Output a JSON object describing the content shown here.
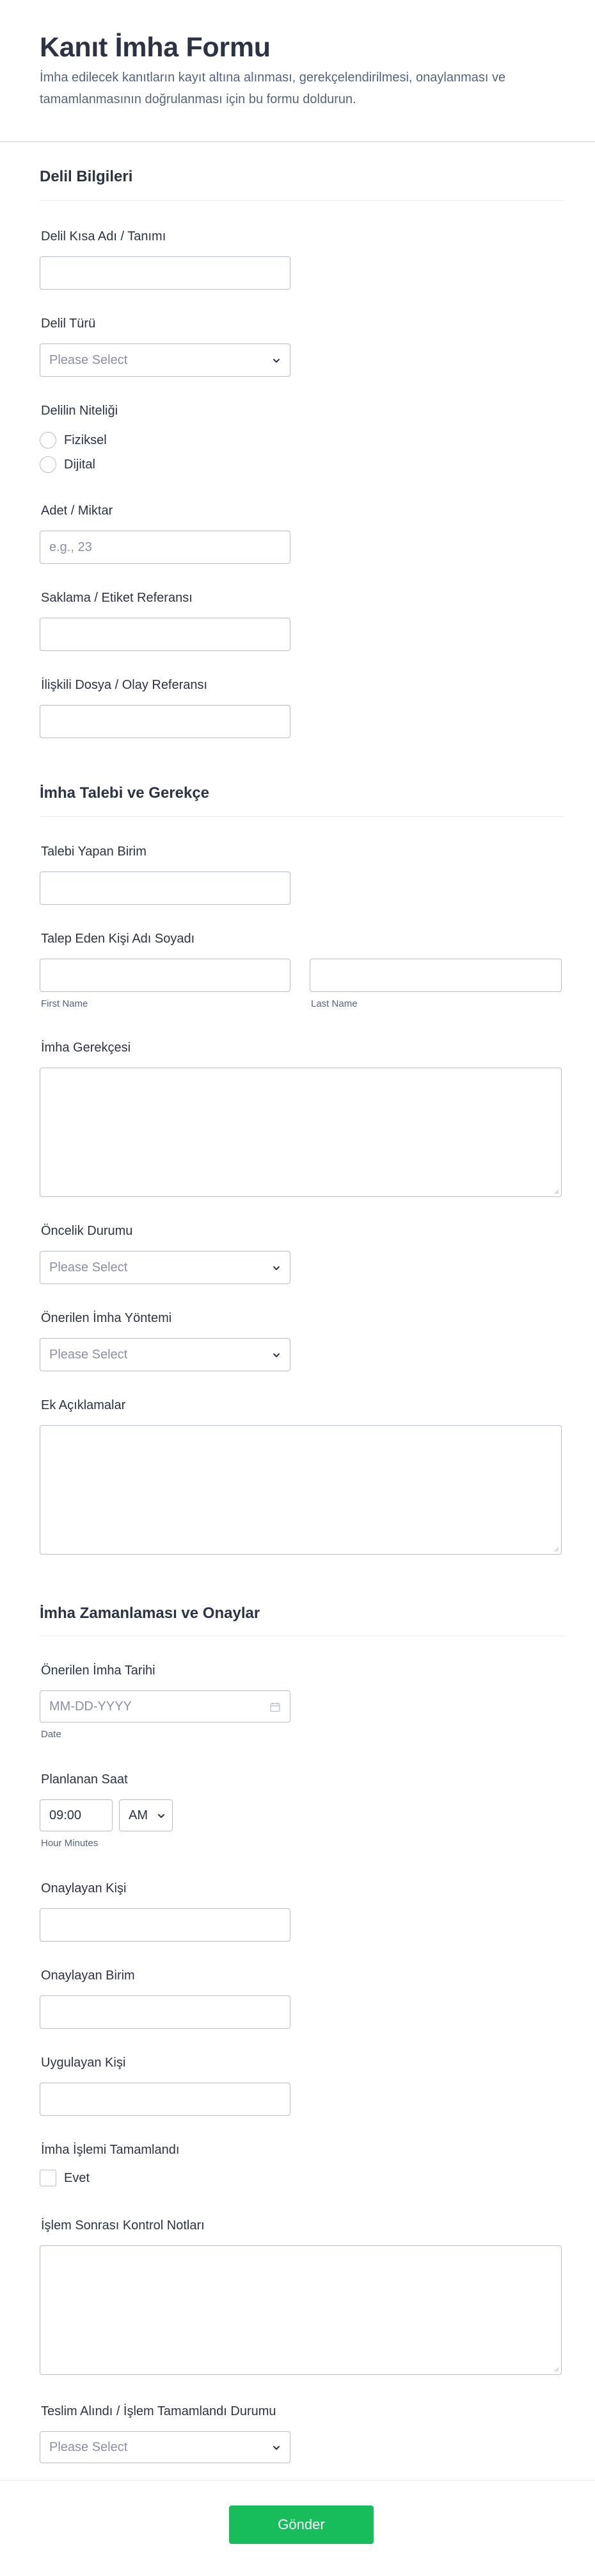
{
  "form": {
    "title": "Kanıt İmha Formu",
    "subtitle": "İmha edilecek kanıtların kayıt altına alınması, gerekçelendirilmesi, onaylanması ve tamamlanmasının doğrulanması için bu formu doldurun."
  },
  "sections": {
    "evidence": "Delil Bilgileri",
    "request": "İmha Talebi ve Gerekçe",
    "schedule": "İmha Zamanlaması ve Onaylar"
  },
  "fields": {
    "evidence_name": {
      "label": "Delil Kısa Adı / Tanımı",
      "value": ""
    },
    "evidence_type": {
      "label": "Delil Türü",
      "placeholder": "Please Select"
    },
    "evidence_nature": {
      "label": "Delilin Niteliği",
      "options": [
        "Fiziksel",
        "Dijital"
      ]
    },
    "quantity": {
      "label": "Adet / Miktar",
      "placeholder": "e.g., 23"
    },
    "storage_ref": {
      "label": "Saklama / Etiket Referansı",
      "value": ""
    },
    "case_ref": {
      "label": "İlişkili Dosya / Olay Referansı",
      "value": ""
    },
    "requesting_unit": {
      "label": "Talebi Yapan Birim",
      "value": ""
    },
    "requester_name": {
      "label": "Talep Eden Kişi Adı Soyadı",
      "first_sublabel": "First Name",
      "last_sublabel": "Last Name"
    },
    "reason": {
      "label": "İmha Gerekçesi",
      "value": ""
    },
    "priority": {
      "label": "Öncelik Durumu",
      "placeholder": "Please Select"
    },
    "method": {
      "label": "Önerilen İmha Yöntemi",
      "placeholder": "Please Select"
    },
    "notes": {
      "label": "Ek Açıklamalar",
      "value": ""
    },
    "proposed_date": {
      "label": "Önerilen İmha Tarihi",
      "placeholder": "MM-DD-YYYY",
      "sublabel": "Date"
    },
    "planned_time": {
      "label": "Planlanan Saat",
      "value": "09:00",
      "ampm": "AM",
      "sublabel": "Hour Minutes"
    },
    "approver": {
      "label": "Onaylayan Kişi",
      "value": ""
    },
    "approving_unit": {
      "label": "Onaylayan Birim",
      "value": ""
    },
    "executor": {
      "label": "Uygulayan Kişi",
      "value": ""
    },
    "completed": {
      "label": "İmha İşlemi Tamamlandı",
      "option": "Evet"
    },
    "post_notes": {
      "label": "İşlem Sonrası Kontrol Notları",
      "value": ""
    },
    "handover_status": {
      "label": "Teslim Alındı / İşlem Tamamlandı Durumu",
      "placeholder": "Please Select"
    }
  },
  "submit_label": "Gönder",
  "colors": {
    "accent": "#18bd5b",
    "border": "#b8bdc9",
    "text": "#2c3345",
    "muted": "#57647e",
    "placeholder": "#8d8fa8"
  }
}
